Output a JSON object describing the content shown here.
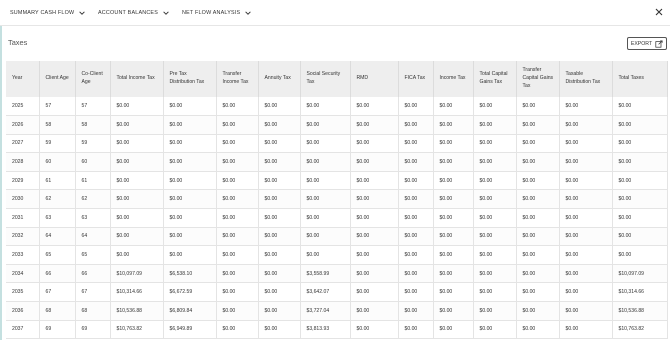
{
  "tabs": [
    {
      "label": "SUMMARY CASH FLOW"
    },
    {
      "label": "ACCOUNT BALANCES"
    },
    {
      "label": "NET FLOW ANALYSIS"
    }
  ],
  "page": {
    "title": "Taxes",
    "export_label": "EXPORT"
  },
  "table": {
    "headers": [
      "Year",
      "Client Age",
      "Co-Client Age",
      "Total Income Tax",
      "Pre Tax Distribution Tax",
      "Transfer Income Tax",
      "Annuity Tax",
      "Social Security Tax",
      "RMD",
      "FICA Tax",
      "Income Tax",
      "Total Capital Gains Tax",
      "Transfer Capital Gains Tax",
      "Taxable Distribution Tax",
      "Total Taxes"
    ],
    "rows": [
      [
        "2025",
        "57",
        "57",
        "$0.00",
        "$0.00",
        "$0.00",
        "$0.00",
        "$0.00",
        "$0.00",
        "$0.00",
        "$0.00",
        "$0.00",
        "$0.00",
        "$0.00",
        "$0.00"
      ],
      [
        "2026",
        "58",
        "58",
        "$0.00",
        "$0.00",
        "$0.00",
        "$0.00",
        "$0.00",
        "$0.00",
        "$0.00",
        "$0.00",
        "$0.00",
        "$0.00",
        "$0.00",
        "$0.00"
      ],
      [
        "2027",
        "59",
        "59",
        "$0.00",
        "$0.00",
        "$0.00",
        "$0.00",
        "$0.00",
        "$0.00",
        "$0.00",
        "$0.00",
        "$0.00",
        "$0.00",
        "$0.00",
        "$0.00"
      ],
      [
        "2028",
        "60",
        "60",
        "$0.00",
        "$0.00",
        "$0.00",
        "$0.00",
        "$0.00",
        "$0.00",
        "$0.00",
        "$0.00",
        "$0.00",
        "$0.00",
        "$0.00",
        "$0.00"
      ],
      [
        "2029",
        "61",
        "61",
        "$0.00",
        "$0.00",
        "$0.00",
        "$0.00",
        "$0.00",
        "$0.00",
        "$0.00",
        "$0.00",
        "$0.00",
        "$0.00",
        "$0.00",
        "$0.00"
      ],
      [
        "2030",
        "62",
        "62",
        "$0.00",
        "$0.00",
        "$0.00",
        "$0.00",
        "$0.00",
        "$0.00",
        "$0.00",
        "$0.00",
        "$0.00",
        "$0.00",
        "$0.00",
        "$0.00"
      ],
      [
        "2031",
        "63",
        "63",
        "$0.00",
        "$0.00",
        "$0.00",
        "$0.00",
        "$0.00",
        "$0.00",
        "$0.00",
        "$0.00",
        "$0.00",
        "$0.00",
        "$0.00",
        "$0.00"
      ],
      [
        "2032",
        "64",
        "64",
        "$0.00",
        "$0.00",
        "$0.00",
        "$0.00",
        "$0.00",
        "$0.00",
        "$0.00",
        "$0.00",
        "$0.00",
        "$0.00",
        "$0.00",
        "$0.00"
      ],
      [
        "2033",
        "65",
        "65",
        "$0.00",
        "$0.00",
        "$0.00",
        "$0.00",
        "$0.00",
        "$0.00",
        "$0.00",
        "$0.00",
        "$0.00",
        "$0.00",
        "$0.00",
        "$0.00"
      ],
      [
        "2034",
        "66",
        "66",
        "$10,097.09",
        "$6,538.10",
        "$0.00",
        "$0.00",
        "$3,558.99",
        "$0.00",
        "$0.00",
        "$0.00",
        "$0.00",
        "$0.00",
        "$0.00",
        "$10,097.09"
      ],
      [
        "2035",
        "67",
        "67",
        "$10,314.66",
        "$6,672.59",
        "$0.00",
        "$0.00",
        "$3,642.07",
        "$0.00",
        "$0.00",
        "$0.00",
        "$0.00",
        "$0.00",
        "$0.00",
        "$10,314.66"
      ],
      [
        "2036",
        "68",
        "68",
        "$10,536.88",
        "$6,809.84",
        "$0.00",
        "$0.00",
        "$3,727.04",
        "$0.00",
        "$0.00",
        "$0.00",
        "$0.00",
        "$0.00",
        "$0.00",
        "$10,536.88"
      ],
      [
        "2037",
        "69",
        "69",
        "$10,763.82",
        "$6,949.89",
        "$0.00",
        "$0.00",
        "$3,813.93",
        "$0.00",
        "$0.00",
        "$0.00",
        "$0.00",
        "$0.00",
        "$0.00",
        "$10,763.82"
      ]
    ]
  },
  "icons": {
    "tab_chevron": "chevron-down-icon",
    "close": "close-icon",
    "export": "export-icon"
  }
}
